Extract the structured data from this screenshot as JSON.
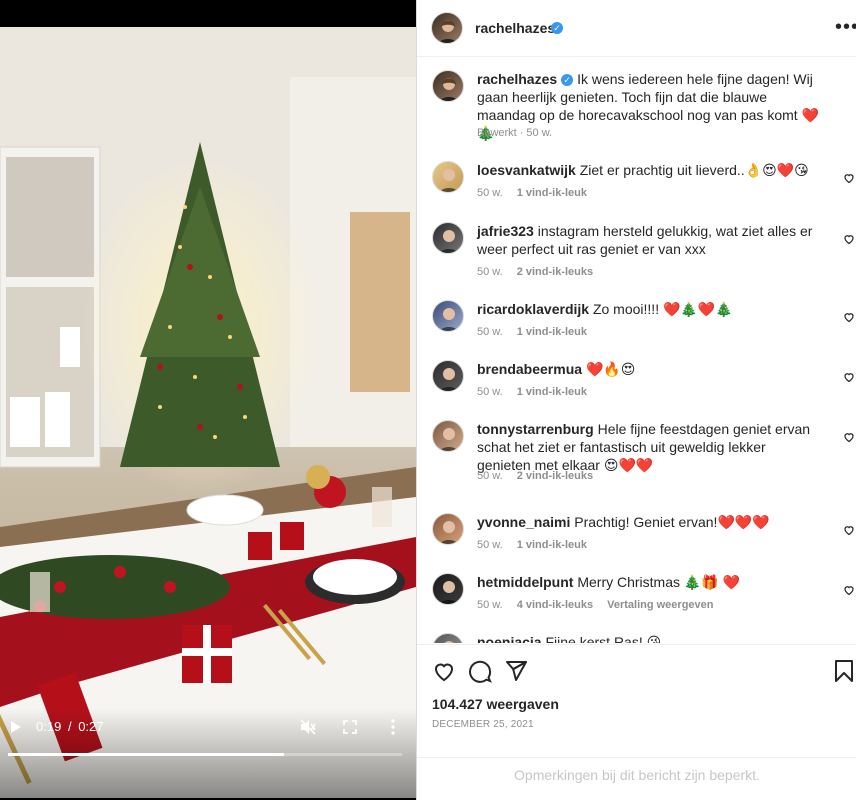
{
  "video": {
    "time_current": "0:19",
    "time_total": "0:27",
    "time_separator": "/",
    "progress": 0.7,
    "icons": [
      "play-icon",
      "mute-icon",
      "fullscreen-icon",
      "more-vertical-icon"
    ]
  },
  "header": {
    "username": "rachelhazes",
    "verified": true,
    "more_label": "•••"
  },
  "caption": {
    "username": "rachelhazes",
    "text": "Ik wens iedereen hele fijne dagen! Wij gaan heerlijk genieten. Toch fijn dat die blauwe maandag op de horecavakschool nog van pas komt ❤️🎄",
    "edited_label": "Bewerkt",
    "separator": "·",
    "age": "50 w."
  },
  "comments": [
    {
      "username": "loesvankatwijk",
      "text": "Ziet er prachtig uit lieverd..👌😍❤️😘",
      "age": "50 w.",
      "likes": "1 vind-ik-leuk",
      "extra": ""
    },
    {
      "username": "jafrie323",
      "text": "instagram hersteld gelukkig, wat ziet alles er weer perfect uit ras geniet er van xxx",
      "age": "50 w.",
      "likes": "2 vind-ik-leuks",
      "extra": ""
    },
    {
      "username": "ricardoklaverdijk",
      "text": "Zo mooi!!!! ❤️🎄❤️🎄",
      "age": "50 w.",
      "likes": "1 vind-ik-leuk",
      "extra": ""
    },
    {
      "username": "brendabeermua",
      "text": "❤️🔥😍",
      "age": "50 w.",
      "likes": "1 vind-ik-leuk",
      "extra": ""
    },
    {
      "username": "tonnystarrenburg",
      "text": "Hele fijne feestdagen geniet ervan schat het ziet er fantastisch uit geweldig lekker genieten met elkaar 😍❤️❤️",
      "age": "50 w.",
      "likes": "2 vind-ik-leuks",
      "extra": ""
    },
    {
      "username": "yvonne_naimi",
      "text": "Prachtig! Geniet ervan!❤️❤️❤️",
      "age": "50 w.",
      "likes": "1 vind-ik-leuk",
      "extra": ""
    },
    {
      "username": "hetmiddelpunt",
      "text": "Merry Christmas 🎄🎁 ❤️",
      "age": "50 w.",
      "likes": "4 vind-ik-leuks",
      "extra": "Vertaling weergeven"
    },
    {
      "username": "noenjacia",
      "text": "Fijne kerst Ras! 😘",
      "age": "",
      "likes": "",
      "extra": ""
    }
  ],
  "actions": {
    "icons": [
      "heart-icon",
      "comment-icon",
      "share-icon",
      "bookmark-icon"
    ],
    "views": "104.427 weergaven",
    "date": "DECEMBER 25, 2021"
  },
  "footer": {
    "notice": "Opmerkingen bij dit bericht zijn beperkt."
  },
  "colors": {
    "verified_blue": "#3897f0",
    "meta_gray": "#8e8e8e",
    "border": "#dbdbdb"
  }
}
